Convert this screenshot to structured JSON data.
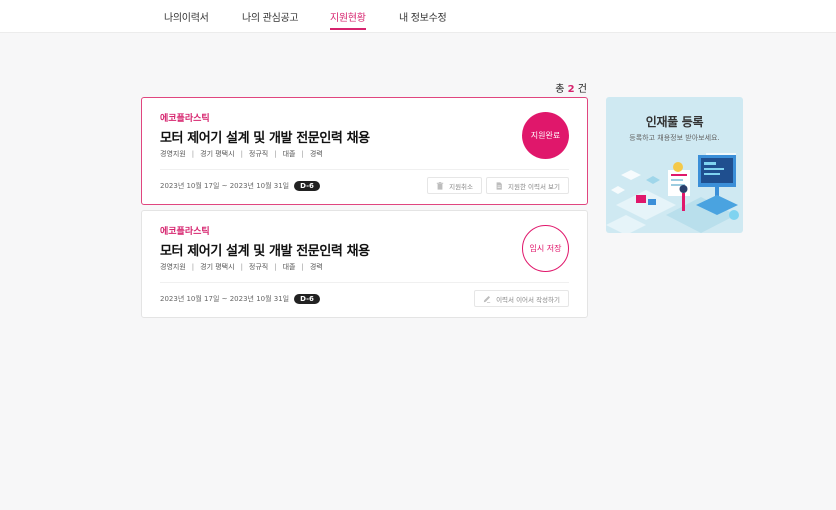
{
  "nav": {
    "tabs": [
      {
        "label": "나의이력서"
      },
      {
        "label": "나의 관심공고"
      },
      {
        "label": "지원현황"
      },
      {
        "label": "내 정보수정"
      }
    ],
    "active": "지원현황"
  },
  "summary": {
    "prefix": "총",
    "count": "2",
    "suffix": "건"
  },
  "cards": [
    {
      "company": "에코플라스틱",
      "title": "모터 제어기 설계 및 개발 전문인력 채용",
      "meta": [
        "경영지원",
        "경기 평택시",
        "정규직",
        "대졸",
        "경력"
      ],
      "period": "2023년 10월 17일 ~ 2023년 10월 31일",
      "dday": "D-6",
      "status": "지원완료",
      "actions": [
        {
          "label": "지원취소",
          "icon": "trash-icon"
        },
        {
          "label": "지원한 이력서 보기",
          "icon": "document-icon"
        }
      ]
    },
    {
      "company": "에코플라스틱",
      "title": "모터 제어기 설계 및 개발 전문인력 채용",
      "meta": [
        "경영지원",
        "경기 평택시",
        "정규직",
        "대졸",
        "경력"
      ],
      "period": "2023년 10월 17일 ~ 2023년 10월 31일",
      "dday": "D-6",
      "status": "임시 저장",
      "actions": [
        {
          "label": "이력서 이어서 작성하기",
          "icon": "pencil-icon"
        }
      ]
    }
  ],
  "sidebar": {
    "title": "인재풀 등록",
    "subtitle": "등록하고 채용정보 받아보세요."
  },
  "colors": {
    "accent": "#e0176b",
    "accent_text": "#d6246e",
    "banner_bg": "#cfe9f2"
  }
}
